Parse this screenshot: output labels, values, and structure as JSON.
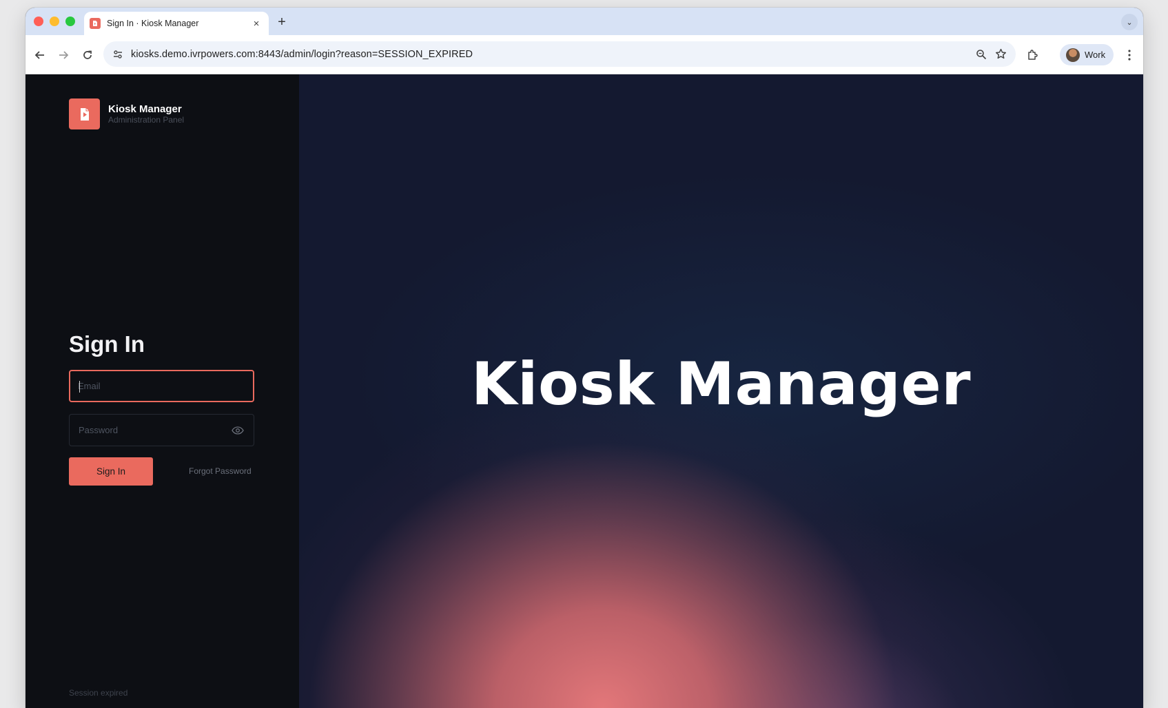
{
  "browser": {
    "tab": {
      "title": "Sign In · Kiosk Manager",
      "close_glyph": "×"
    },
    "new_tab_glyph": "+",
    "tab_search_glyph": "⌄",
    "url": "kiosks.demo.ivrpowers.com:8443/admin/login?reason=SESSION_EXPIRED",
    "profile_label": "Work",
    "icons": [
      "back-icon",
      "forward-icon",
      "reload-icon",
      "site-settings-icon",
      "zoom-icon",
      "bookmark-star-icon",
      "extensions-icon",
      "more-menu-icon"
    ]
  },
  "brand": {
    "name": "Kiosk Manager",
    "subtitle": "Administration Panel",
    "accent": "#ea6a5e"
  },
  "login": {
    "title": "Sign In",
    "email_placeholder": "Email",
    "password_placeholder": "Password",
    "submit_label": "Sign In",
    "forgot_label": "Forgot Password",
    "session_note": "Session expired"
  },
  "hero": {
    "title": "Kiosk Manager"
  }
}
